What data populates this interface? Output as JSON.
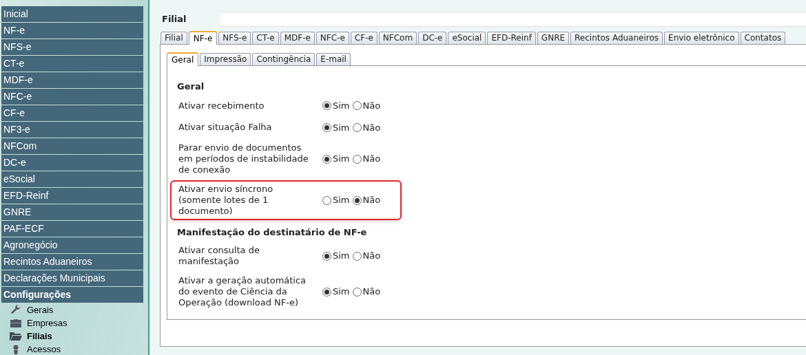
{
  "sidebar": {
    "items": [
      {
        "label": "Inicial"
      },
      {
        "label": "NF-e"
      },
      {
        "label": "NFS-e"
      },
      {
        "label": "CT-e"
      },
      {
        "label": "MDF-e"
      },
      {
        "label": "NFC-e"
      },
      {
        "label": "CF-e"
      },
      {
        "label": "NF3-e"
      },
      {
        "label": "NFCom"
      },
      {
        "label": "DC-e"
      },
      {
        "label": "eSocial"
      },
      {
        "label": "EFD-Reinf"
      },
      {
        "label": "GNRE"
      },
      {
        "label": "PAF-ECF"
      },
      {
        "label": "Agronegócio"
      },
      {
        "label": "Recintos Aduaneiros"
      },
      {
        "label": "Declarações Municipais"
      },
      {
        "label": "Configurações",
        "children": [
          {
            "label": "Gerais",
            "kind": "wrench",
            "selected": false
          },
          {
            "label": "Empresas",
            "kind": "briefcase",
            "selected": false
          },
          {
            "label": "Filiais",
            "kind": "folder",
            "selected": true
          },
          {
            "label": "Acessos",
            "kind": "person",
            "selected": false
          }
        ]
      }
    ]
  },
  "filial": {
    "label": "Filial"
  },
  "tabs": [
    {
      "label": "Filial",
      "selected": false
    },
    {
      "label": "NF-e",
      "selected": true
    },
    {
      "label": "NFS-e",
      "selected": false
    },
    {
      "label": "CT-e",
      "selected": false
    },
    {
      "label": "MDF-e",
      "selected": false
    },
    {
      "label": "NFC-e",
      "selected": false
    },
    {
      "label": "CF-e",
      "selected": false
    },
    {
      "label": "NFCom",
      "selected": false
    },
    {
      "label": "DC-e",
      "selected": false
    },
    {
      "label": "eSocial",
      "selected": false
    },
    {
      "label": "EFD-Reinf",
      "selected": false
    },
    {
      "label": "GNRE",
      "selected": false
    },
    {
      "label": "Recintos Aduaneiros",
      "selected": false
    },
    {
      "label": "Envio eletrônico",
      "selected": false
    },
    {
      "label": "Contatos",
      "selected": false
    }
  ],
  "subtabs": [
    {
      "label": "Geral",
      "selected": true
    },
    {
      "label": "Impressão",
      "selected": false
    },
    {
      "label": "Contingência",
      "selected": false
    },
    {
      "label": "E-mail",
      "selected": false
    }
  ],
  "sections": [
    {
      "title": "Geral",
      "settings": [
        {
          "label": "Ativar recebimento",
          "highlighted": false,
          "options": [
            {
              "label": "Sim",
              "selected": true
            },
            {
              "label": "Não",
              "selected": false
            }
          ]
        },
        {
          "label": "Ativar situação Falha",
          "highlighted": false,
          "options": [
            {
              "label": "Sim",
              "selected": true
            },
            {
              "label": "Não",
              "selected": false
            }
          ]
        },
        {
          "label": "Parar envio de documentos em períodos de instabilidade de conexão",
          "highlighted": false,
          "options": [
            {
              "label": "Sim",
              "selected": true
            },
            {
              "label": "Não",
              "selected": false
            }
          ]
        },
        {
          "label": "Ativar envio síncrono (somente lotes de 1 documento)",
          "highlighted": true,
          "options": [
            {
              "label": "Sim",
              "selected": false
            },
            {
              "label": "Não",
              "selected": true
            }
          ]
        }
      ]
    },
    {
      "title": "Manifestação do destinatário de NF-e",
      "settings": [
        {
          "label": "Ativar consulta de manifestação",
          "highlighted": false,
          "options": [
            {
              "label": "Sim",
              "selected": true
            },
            {
              "label": "Não",
              "selected": false
            }
          ]
        },
        {
          "label": "Ativar a geração automática do evento de Ciência da Operação (download NF-e)",
          "highlighted": false,
          "options": [
            {
              "label": "Sim",
              "selected": true
            },
            {
              "label": "Não",
              "selected": false
            }
          ]
        }
      ]
    }
  ]
}
